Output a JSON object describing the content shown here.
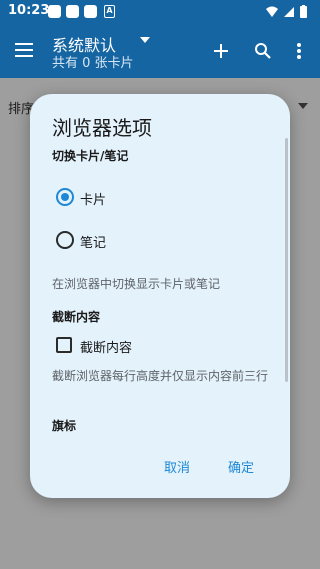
{
  "status_bar": {
    "time": "10:23",
    "icons": [
      "notification-icon",
      "notification-icon",
      "notification-icon",
      "accessibility-icon"
    ]
  },
  "app_bar": {
    "menu_icon": "hamburger-menu-icon",
    "title": "系统默认",
    "subtitle": "共有 0 张卡片",
    "actions": [
      "add-icon",
      "search-icon",
      "more-vert-icon"
    ]
  },
  "page": {
    "sort_label": "排序"
  },
  "dialog": {
    "title": "浏览器选项",
    "switch_section": {
      "heading": "切换卡片/笔记",
      "options": [
        {
          "label": "卡片",
          "selected": true
        },
        {
          "label": "笔记",
          "selected": false
        }
      ],
      "hint": "在浏览器中切换显示卡片或笔记"
    },
    "truncate_section": {
      "heading": "截断内容",
      "checkbox_label": "截断内容",
      "checked": false,
      "hint": "截断浏览器每行高度并仅显示内容前三行"
    },
    "flag_section": {
      "heading": "旗标"
    },
    "buttons": {
      "cancel": "取消",
      "ok": "确定"
    }
  },
  "colors": {
    "app_bar": "#1565a3",
    "dialog_bg": "#e3f2fb",
    "accent": "#1e88d6"
  }
}
